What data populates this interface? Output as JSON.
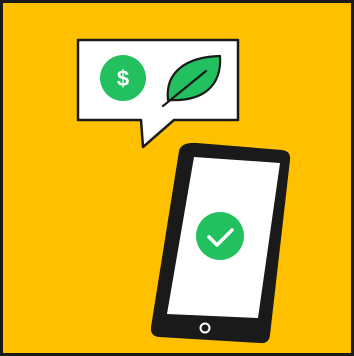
{
  "illustration": {
    "background_color": "#FFC000",
    "border_color": "#1A1A1A",
    "bubble": {
      "dollar_symbol": "$",
      "icons": [
        "dollar-icon",
        "leaf-icon"
      ]
    },
    "phone": {
      "status_icon": "checkmark-icon"
    },
    "colors": {
      "accent_green": "#22C05E",
      "ink": "#1A1A1A",
      "paper": "#FFFFFF",
      "speaker": "#2A2A2A"
    }
  }
}
